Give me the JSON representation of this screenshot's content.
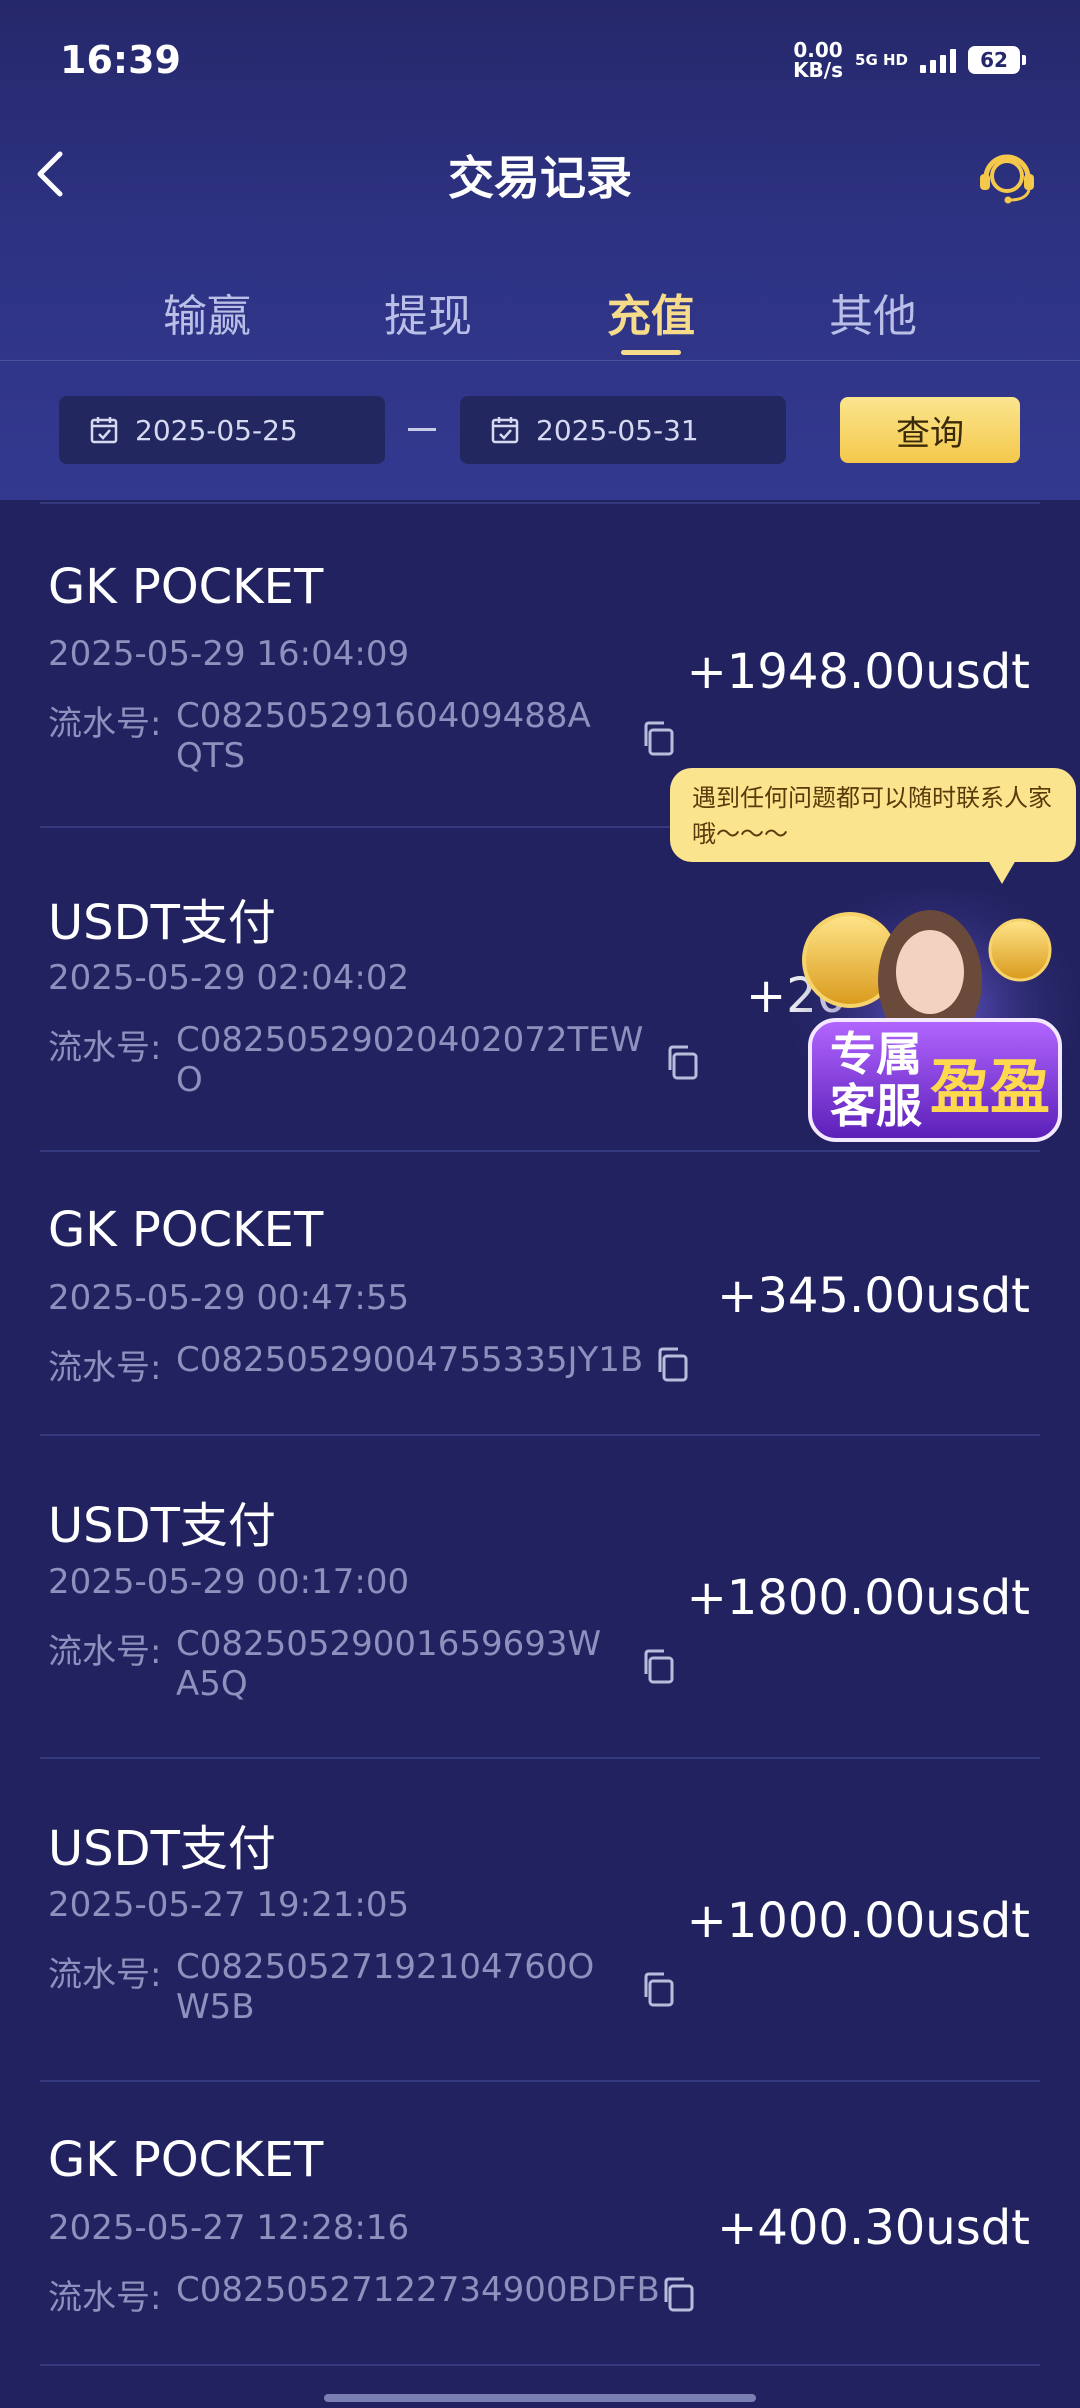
{
  "status_bar": {
    "time": "16:39",
    "net_speed_value": "0.00",
    "net_speed_unit": "KB/s",
    "net_type_top": "5G HD",
    "battery": "62"
  },
  "header": {
    "title": "交易记录"
  },
  "tabs": [
    {
      "label": "输赢",
      "active": false
    },
    {
      "label": "提现",
      "active": false
    },
    {
      "label": "充值",
      "active": true
    },
    {
      "label": "其他",
      "active": false
    }
  ],
  "filter": {
    "start_date": "2025-05-25",
    "end_date": "2025-05-31",
    "query_label": "查询"
  },
  "records": [
    {
      "name": "GK POCKET",
      "time": "2025-05-29 16:04:09",
      "serial_label": "流水号:",
      "serial": "C08250529160409488AQTS",
      "amount": "+1948.00usdt"
    },
    {
      "name": "USDT支付",
      "time": "2025-05-29 02:04:02",
      "serial_label": "流水号:",
      "serial": "C08250529020402072TEWO",
      "amount": "+20"
    },
    {
      "name": "GK POCKET",
      "time": "2025-05-29 00:47:55",
      "serial_label": "流水号:",
      "serial": "C08250529004755335JY1B",
      "amount": "+345.00usdt"
    },
    {
      "name": "USDT支付",
      "time": "2025-05-29 00:17:00",
      "serial_label": "流水号:",
      "serial": "C08250529001659693WA5Q",
      "amount": "+1800.00usdt"
    },
    {
      "name": "USDT支付",
      "time": "2025-05-27 19:21:05",
      "serial_label": "流水号:",
      "serial": "C08250527192104760OW5B",
      "amount": "+1000.00usdt"
    },
    {
      "name": "GK POCKET",
      "time": "2025-05-27 12:28:16",
      "serial_label": "流水号:",
      "serial": "C08250527122734900BDFB",
      "amount": "+400.30usdt"
    }
  ],
  "support_popup": {
    "message": "遇到任何问题都可以随时联系人家哦～～～",
    "banner_line1": "专属",
    "banner_line2": "客服",
    "banner_name": "盈盈"
  },
  "colors": {
    "background": "#222260",
    "accent_gold": "#f6dc8a",
    "muted_text": "#8d91bd"
  },
  "icons": [
    "back-arrow-icon",
    "customer-service-headset-icon",
    "calendar-icon",
    "copy-icon"
  ]
}
